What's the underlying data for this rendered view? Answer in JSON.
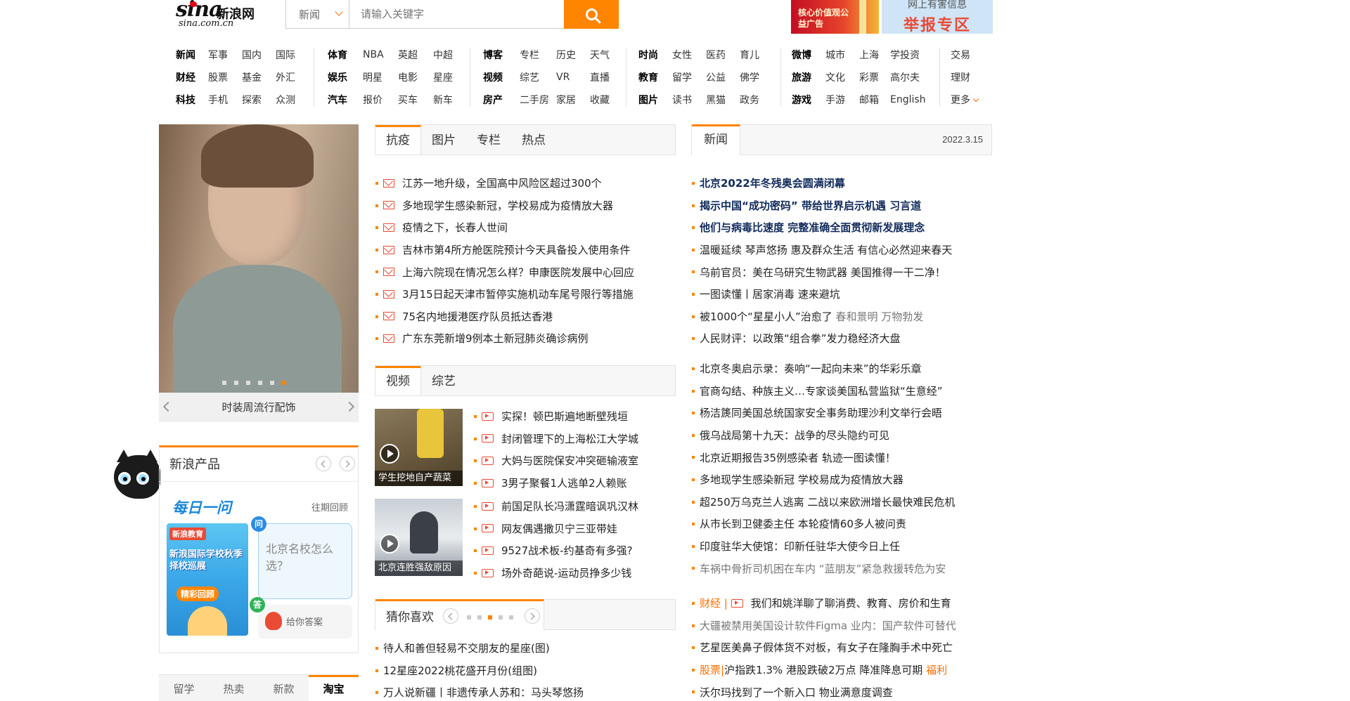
{
  "logo": {
    "brand": "sina",
    "brand_cn": "新浪网",
    "domain": "sina.com.cn"
  },
  "search": {
    "category": "新闻",
    "placeholder": "请输入关键字"
  },
  "ads": {
    "left_text": "核心价值观公益广告",
    "right_line1": "网上有害信息",
    "right_line2": "举报专区"
  },
  "nav": [
    {
      "rows": [
        [
          "新闻",
          "军事",
          "国内",
          "国际"
        ],
        [
          "财经",
          "股票",
          "基金",
          "外汇"
        ],
        [
          "科技",
          "手机",
          "探索",
          "众测"
        ]
      ]
    },
    {
      "rows": [
        [
          "体育",
          "NBA",
          "英超",
          "中超"
        ],
        [
          "娱乐",
          "明星",
          "电影",
          "星座"
        ],
        [
          "汽车",
          "报价",
          "买车",
          "新车"
        ]
      ]
    },
    {
      "rows": [
        [
          "博客",
          "专栏",
          "历史",
          "天气"
        ],
        [
          "视频",
          "综艺",
          "VR",
          "直播"
        ],
        [
          "房产",
          "二手房",
          "家居",
          "收藏"
        ]
      ]
    },
    {
      "rows": [
        [
          "时尚",
          "女性",
          "医药",
          "育儿"
        ],
        [
          "教育",
          "留学",
          "公益",
          "佛学"
        ],
        [
          "图片",
          "读书",
          "黑猫",
          "政务"
        ]
      ]
    },
    {
      "rows": [
        [
          "微博",
          "城市",
          "上海",
          "学投资"
        ],
        [
          "旅游",
          "文化",
          "彩票",
          "高尔夫"
        ],
        [
          "游戏",
          "手游",
          "邮箱",
          "English"
        ]
      ]
    },
    {
      "rows": [
        [
          "交易"
        ],
        [
          "理财"
        ],
        [
          "更多"
        ]
      ]
    }
  ],
  "slider": {
    "caption": "时装周流行配饰",
    "dot_count": 6,
    "active_dot": 5
  },
  "products": {
    "title": "新浪产品",
    "daily_title": "每日一问",
    "past_label": "往期回顾",
    "edu_header": "新浪教育",
    "edu_title": "新浪国际学校秋季择校巡展",
    "edu_badge": "精彩回顾",
    "question_badge": "问",
    "question": "北京名校怎么选？",
    "answer_badge": "答",
    "answer_button": "给你答案"
  },
  "bottom_tabs": [
    {
      "label": "留学",
      "active": false
    },
    {
      "label": "热卖",
      "active": false
    },
    {
      "label": "新款",
      "active": false
    },
    {
      "label": "淘宝",
      "active": true
    }
  ],
  "middle": {
    "tabs": [
      {
        "label": "抗疫",
        "active": true
      },
      {
        "label": "图片",
        "active": false
      },
      {
        "label": "专栏",
        "active": false
      },
      {
        "label": "热点",
        "active": false
      }
    ],
    "news": [
      "江苏一地升级，全国高中风险区超过300个",
      "多地现学生感染新冠，学校易成为疫情放大器",
      "疫情之下，长春人世间",
      "吉林市第4所方舱医院预计今天具备投入使用条件",
      "上海六院现在情况怎么样？申康医院发展中心回应",
      "3月15日起天津市暂停实施机动车尾号限行等措施",
      "75名内地援港医疗队员抵达香港",
      "广东东莞新增9例本土新冠肺炎确诊病例"
    ],
    "video_tabs": [
      {
        "label": "视频",
        "active": true
      },
      {
        "label": "综艺",
        "active": false
      }
    ],
    "thumbs": [
      {
        "caption": "学生挖地自产蔬菜"
      },
      {
        "caption": "北京连胜强敌原因"
      }
    ],
    "videos": [
      "实探！顿巴斯遍地断壁残垣",
      "封闭管理下的上海松江大学城",
      "大妈与医院保安冲突砸输液室",
      "3男子聚餐1人逃单2人赖账",
      "前国足队长冯潇霆暗讽巩汉林",
      "网友偶遇撒贝宁三亚带娃",
      "9527战术板-约基奇有多强?",
      "场外奇葩说-运动员挣多少钱"
    ],
    "guess": {
      "label": "猜你喜欢",
      "dot_count": 5,
      "active_dot": 2
    },
    "guess_news": [
      "待人和善但轻易不交朋友的星座(图)",
      "12星座2022桃花盛开月份(组图)",
      "万人说新疆丨非遗传承人苏和：马头琴悠扬"
    ]
  },
  "right": {
    "tab": "新闻",
    "date": "2022.3.15",
    "top_news": [
      {
        "text": "北京2022年冬残奥会圆满闭幕",
        "style": "bold"
      },
      {
        "text": "揭示中国“成功密码” 带给世界启示机遇 习言道",
        "style": "bold"
      },
      {
        "text": "他们与病毒比速度 完整准确全面贯彻新发展理念",
        "style": "bold"
      },
      {
        "text": "温暖延续 琴声悠扬 惠及群众生活 有信心必然迎来春天",
        "style": "normal"
      },
      {
        "text": "乌前官员：美在乌研究生物武器 美国推得一干二净！",
        "style": "normal"
      },
      {
        "text": "一图读懂丨居家消毒 速来避坑",
        "style": "normal"
      },
      {
        "text": "被1000个“星星小人”治愈了",
        "extra": "春和景明 万物勃发",
        "style": "normal"
      },
      {
        "text": "人民财评：以政策“组合拳”发力稳经济大盘",
        "style": "normal"
      }
    ],
    "news2": [
      "北京冬奥启示录：奏响“一起向未来”的华彩乐章",
      "官商勾结、种族主义…专家谈美国私营监狱“生意经”",
      "杨洁篪同美国总统国家安全事务助理沙利文举行会晤",
      "俄乌战局第十九天：战争的尽头隐约可见",
      "北京近期报告35例感染者 轨迹一图读懂！",
      "多地现学生感染新冠 学校易成为疫情放大器",
      "超250万乌克兰人逃离 二战以来欧洲增长最快难民危机",
      "从市长到卫健委主任 本轮疫情60多人被问责",
      "印度驻华大使馆：印新任驻华大使今日上任",
      "车祸中骨折司机困在车内 “蓝朋友”紧急救援转危为安"
    ],
    "finance_label": "财经 |",
    "finance_first": "我们和姚洋聊了聊消费、教育、房价和生育",
    "finance_news": [
      "大疆被禁用美国设计软件Figma 业内：国产软件可替代",
      "艺星医美鼻子假体货不对板，有女子在隆胸手术中死亡"
    ],
    "stock_label": "股票|",
    "stock_text": "沪指跌1.3% 港股跌破2万点 降准降息可期",
    "stock_extra": "福利",
    "last_news": "沃尔玛找到了一个新入口 物业满意度调查"
  }
}
